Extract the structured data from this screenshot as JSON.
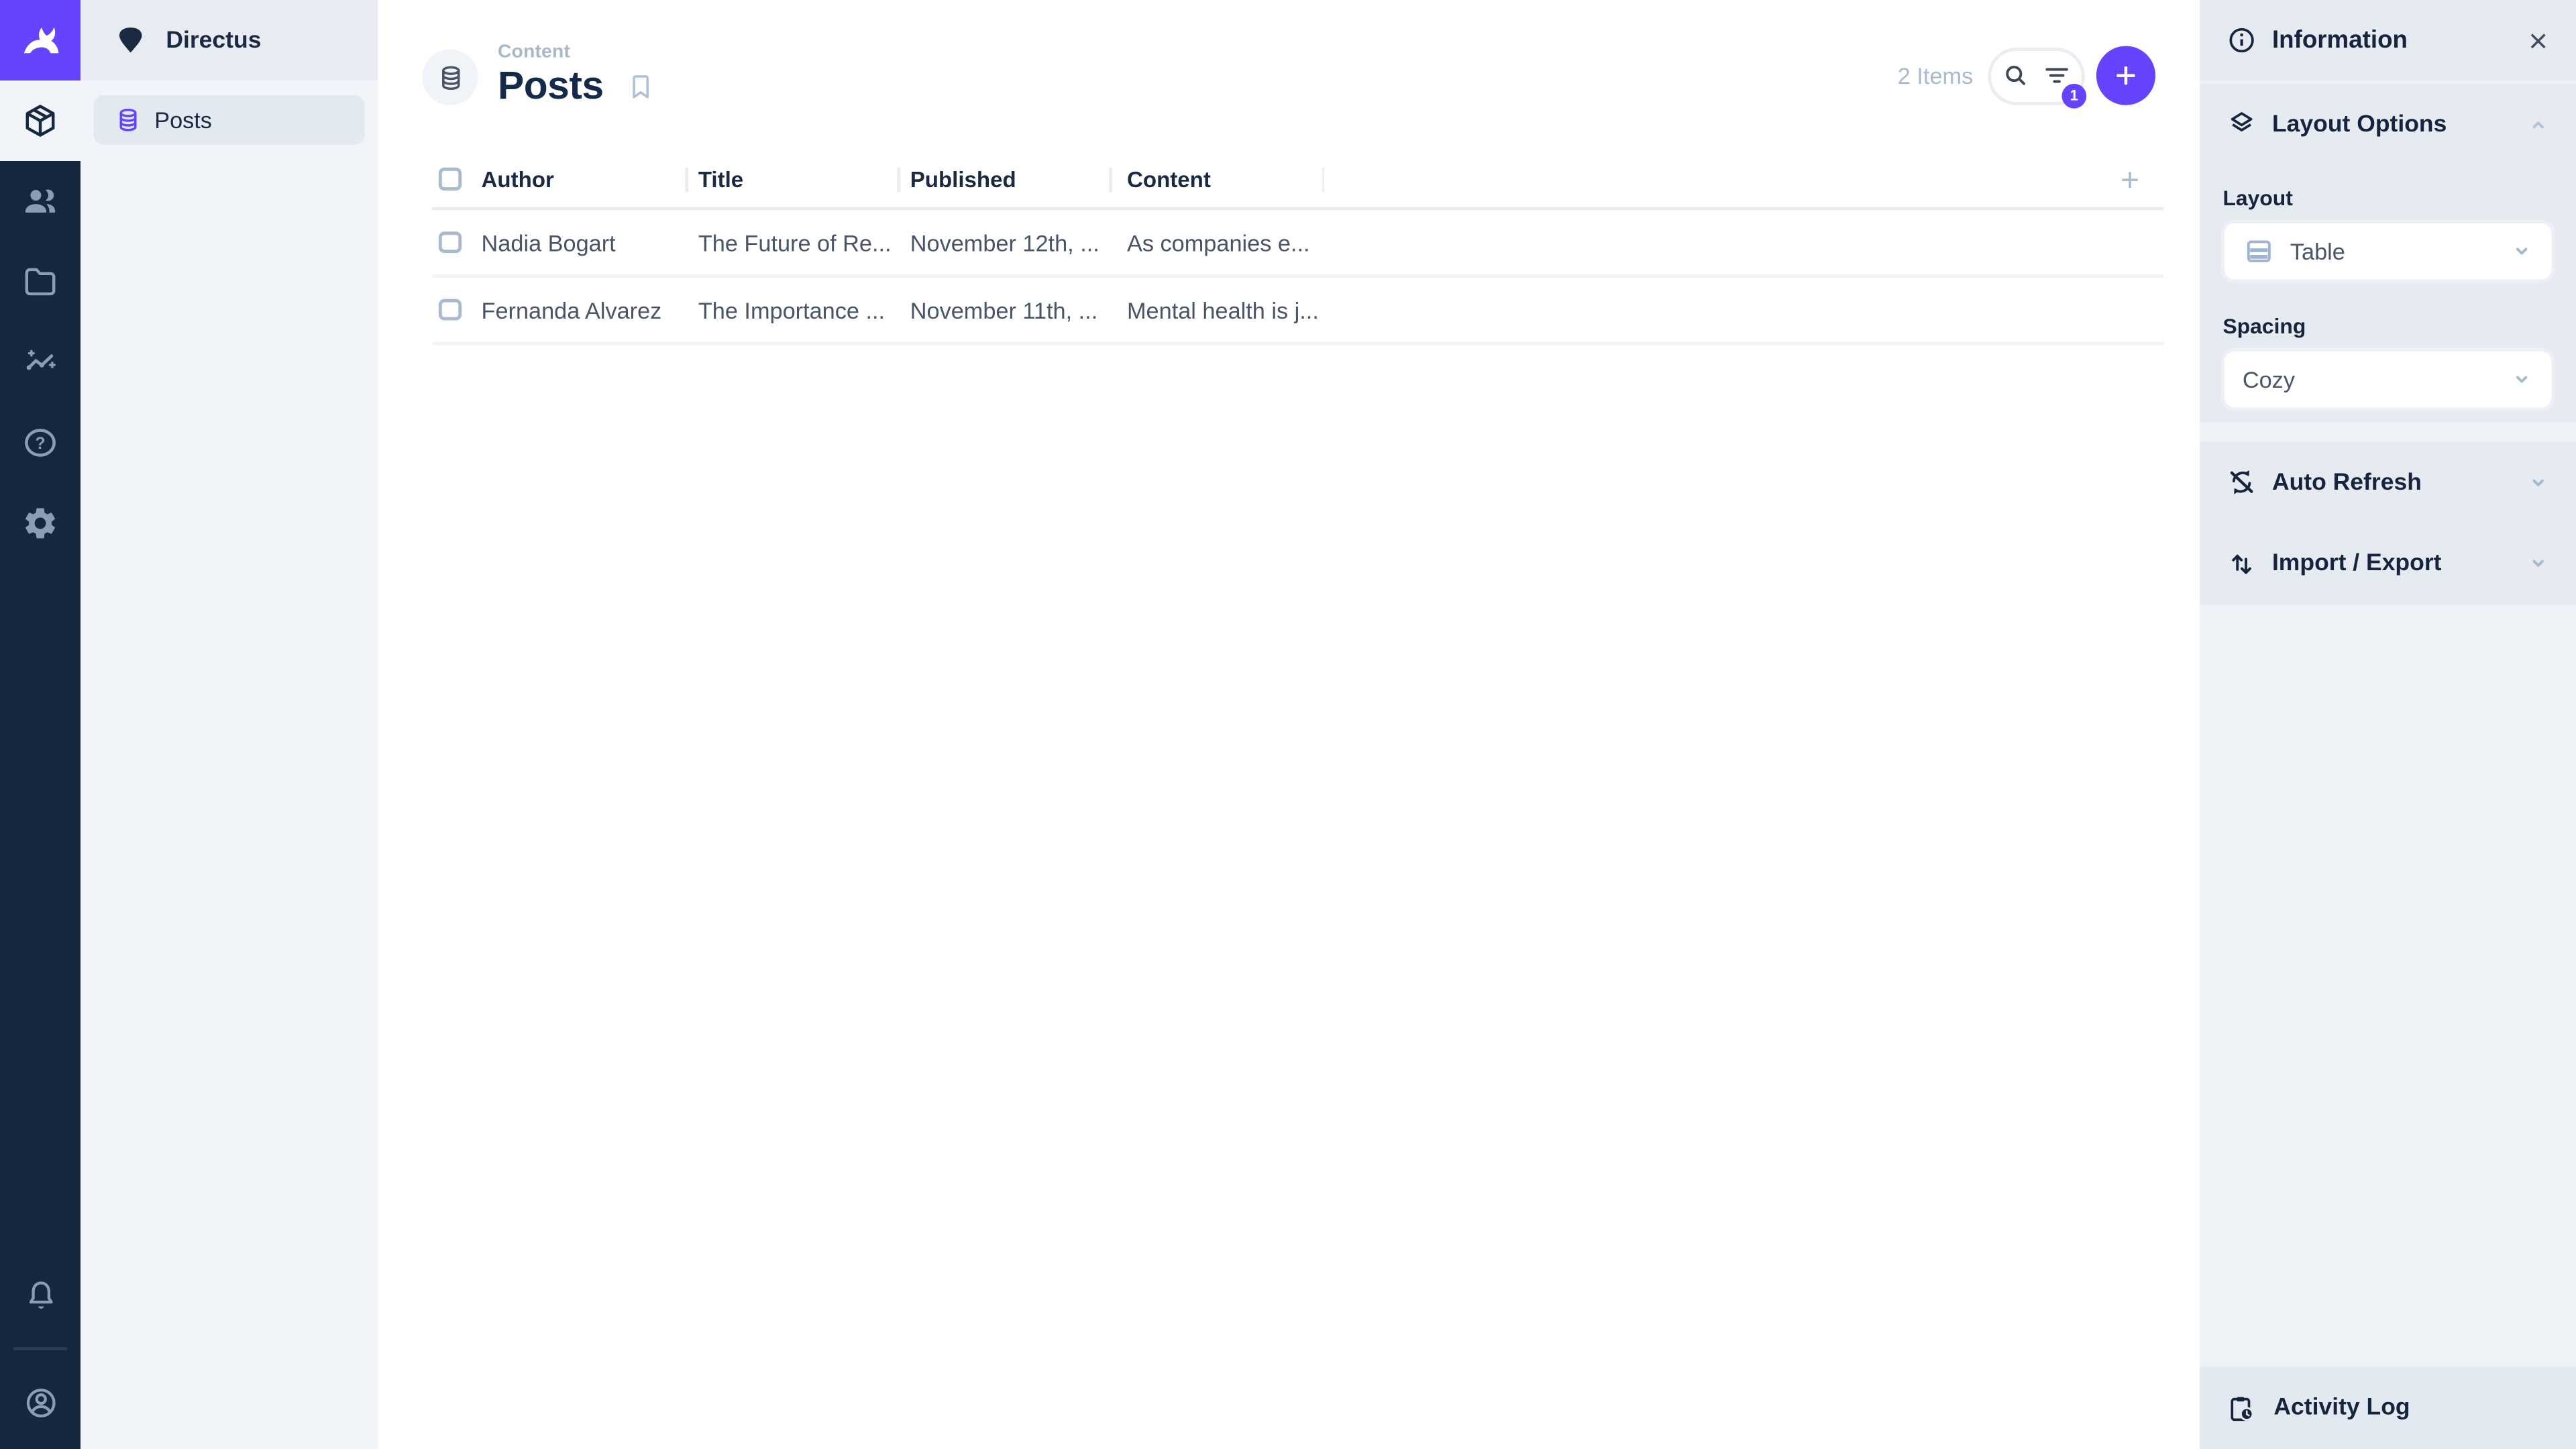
{
  "nav": {
    "project_name": "Directus",
    "collection_item": "Posts"
  },
  "header": {
    "eyebrow": "Content",
    "title": "Posts",
    "items_count": "2 Items",
    "filter_badge": "1"
  },
  "table": {
    "columns": [
      {
        "label": "Author"
      },
      {
        "label": "Title"
      },
      {
        "label": "Published"
      },
      {
        "label": "Content"
      }
    ],
    "rows": [
      {
        "author": "Nadia Bogart",
        "title": "The Future of Re...",
        "published": "November 12th, ...",
        "content": "As companies e..."
      },
      {
        "author": "Fernanda Alvarez",
        "title": "The Importance ...",
        "published": "November 11th, ...",
        "content": "Mental health is j..."
      }
    ]
  },
  "sidebar": {
    "title": "Information",
    "layout_options": {
      "label": "Layout Options",
      "layout_label": "Layout",
      "layout_value": "Table",
      "spacing_label": "Spacing",
      "spacing_value": "Cozy"
    },
    "auto_refresh": {
      "label": "Auto Refresh"
    },
    "import_export": {
      "label": "Import / Export"
    },
    "activity_log": {
      "label": "Activity Log"
    }
  },
  "icons": {
    "rail": [
      "directus-rabbit-logo",
      "content-module-cube-icon",
      "users-icon",
      "files-folder-icon",
      "insights-icon",
      "help-icon",
      "settings-gear-icon",
      "notifications-bell-icon",
      "account-circle-icon"
    ],
    "header": [
      "collection-database-icon",
      "bookmark-icon",
      "search-icon",
      "filter-icon",
      "plus-icon"
    ],
    "sidebar": [
      "info-icon",
      "close-icon",
      "layers-icon",
      "chevron-up-icon",
      "table-layout-icon",
      "chevron-down-icon",
      "sync-disabled-icon",
      "import-export-arrows-icon",
      "activity-clipboard-icon"
    ]
  },
  "colors": {
    "accent": "#6644FF",
    "rail_bg": "#16263C",
    "rail_icon": "#8B9DB6",
    "text_dark": "#1B2A41",
    "text_muted": "#A9BACE",
    "row_text": "#4A5468",
    "sidebar_bg": "#EFF3F8",
    "section_bg": "#E6EBF2",
    "activity_bg": "#E3E9F0"
  }
}
